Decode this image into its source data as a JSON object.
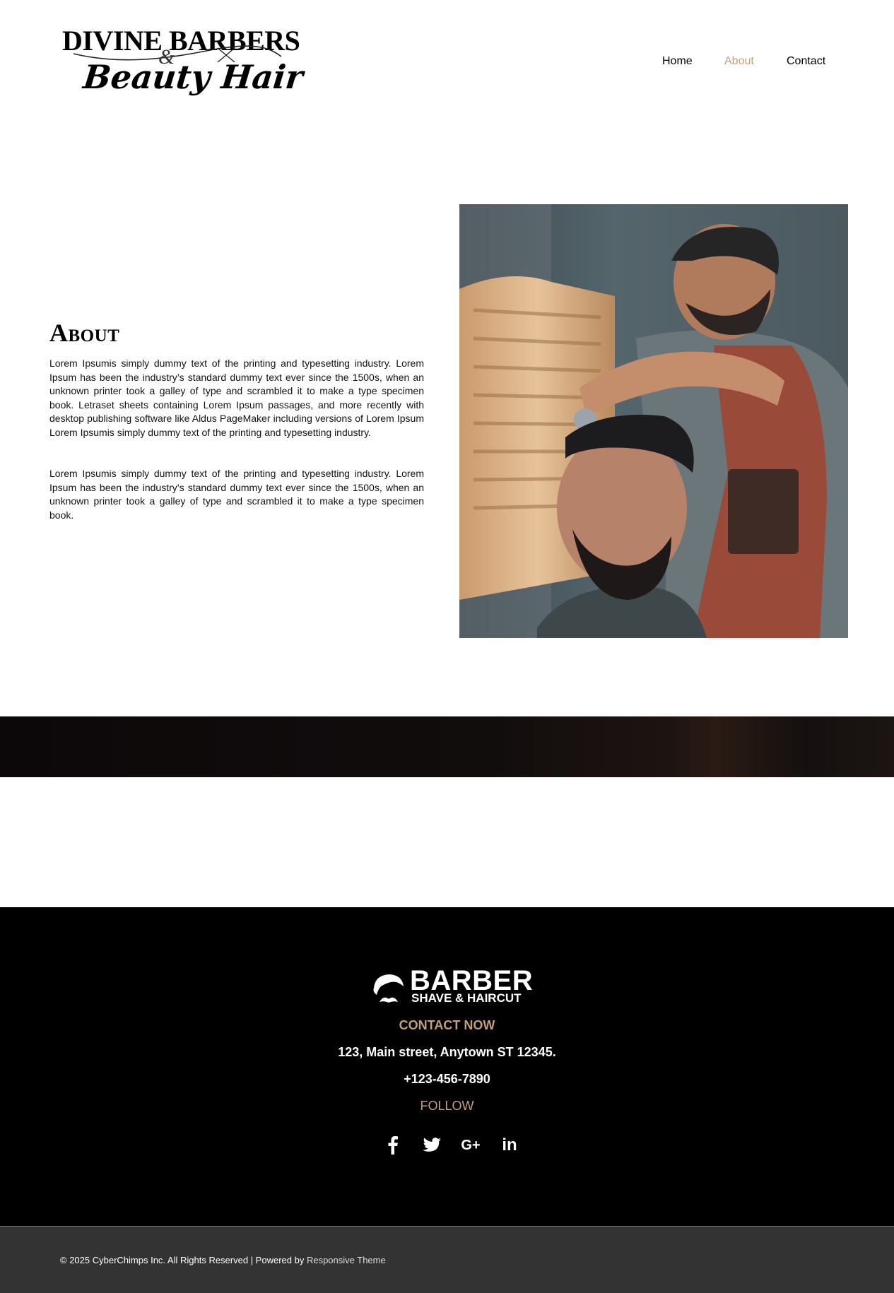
{
  "header": {
    "logo": {
      "line1": "DIVINE BARBERS",
      "amp": "&",
      "line2": "Beauty Hair"
    },
    "nav": [
      {
        "label": "Home",
        "active": false
      },
      {
        "label": "About",
        "active": true
      },
      {
        "label": "Contact",
        "active": false
      }
    ]
  },
  "about": {
    "title": "About",
    "paragraphs": [
      "Lorem Ipsumis simply dummy text of the printing and typesetting industry. Lorem Ipsum has been the industry’s standard dummy text ever since the 1500s, when an unknown printer took a galley of type and scrambled it to make a type specimen book. Letraset sheets containing Lorem Ipsum passages, and more recently with desktop publishing software like Aldus PageMaker including versions of Lorem Ipsum Lorem Ipsumis simply dummy text of the printing and typesetting industry.",
      "Lorem Ipsumis simply dummy text of the printing and typesetting industry. Lorem Ipsum has been the industry’s standard dummy text ever since the 1500s, when an unknown printer took a galley of type and scrambled it to make a type specimen book."
    ]
  },
  "footer": {
    "brand_line1": "BARBER",
    "brand_line2": "SHAVE & HAIRCUT",
    "contact_heading": "CONTACT NOW",
    "address": "123, Main street, Anytown ST 12345.",
    "phone": "+123-456-7890",
    "follow_heading": "FOLLOW",
    "socials": [
      {
        "icon": "facebook-icon"
      },
      {
        "icon": "twitter-icon"
      },
      {
        "icon": "google-plus-icon",
        "glyph": "G+"
      },
      {
        "icon": "linkedin-icon",
        "glyph": "in"
      }
    ],
    "copyright_text": "© 2025 CyberChimps Inc. All Rights Reserved | Powered by ",
    "copyright_link": "Responsive Theme"
  },
  "colors": {
    "accent": "#c4a07a",
    "footer_bg": "#000000",
    "bottom_bar_bg": "#333333"
  }
}
